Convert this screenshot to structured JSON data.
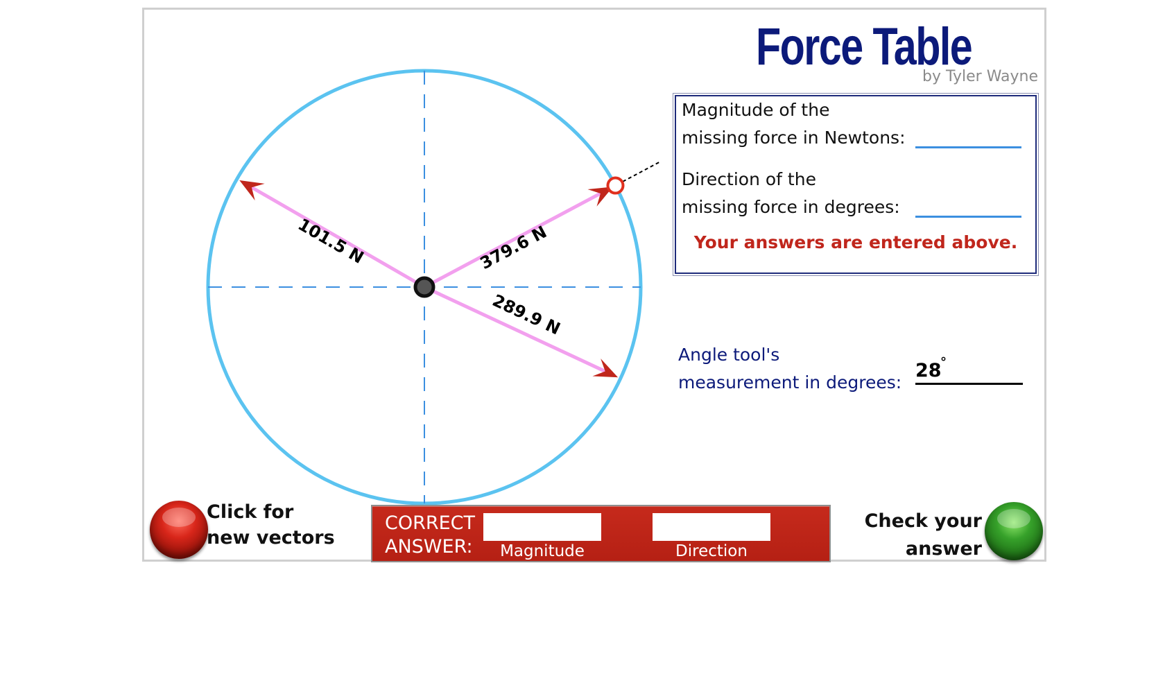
{
  "app": {
    "title": "Force Table",
    "byline": "by Tyler Wayne"
  },
  "force_table": {
    "vectors": [
      {
        "label": "101.5 N",
        "angle_deg": 150,
        "color": "#f2a0ee",
        "arrow_color": "#c0261c"
      },
      {
        "label": "379.6 N",
        "angle_deg": 28,
        "color": "#f2a0ee",
        "arrow_color": "#c0261c"
      },
      {
        "label": "289.9 N",
        "angle_deg": -25,
        "color": "#f2a0ee",
        "arrow_color": "#c0261c"
      }
    ],
    "angle_tool_deg": 28,
    "circle_color": "#5bc3f0",
    "axis_color": "#3b8fe0"
  },
  "answer_panel": {
    "magnitude_label_1": "Magnitude of the",
    "magnitude_label_2": "missing force in Newtons:",
    "magnitude_value": "",
    "direction_label_1": "Direction of the",
    "direction_label_2": "missing force in degrees:",
    "direction_value": "",
    "status": "Your answers are entered above."
  },
  "angle_tool": {
    "label_1": "Angle tool's",
    "label_2": "measurement in degrees:",
    "value": "28",
    "unit": "°"
  },
  "buttons": {
    "new_vectors_1": "Click for",
    "new_vectors_2": "new vectors",
    "check_1": "Check your",
    "check_2": "answer"
  },
  "correct_answer": {
    "label_1": "CORRECT",
    "label_2": "ANSWER:",
    "magnitude_caption": "Magnitude",
    "direction_caption": "Direction",
    "magnitude_value": "",
    "direction_value": ""
  }
}
